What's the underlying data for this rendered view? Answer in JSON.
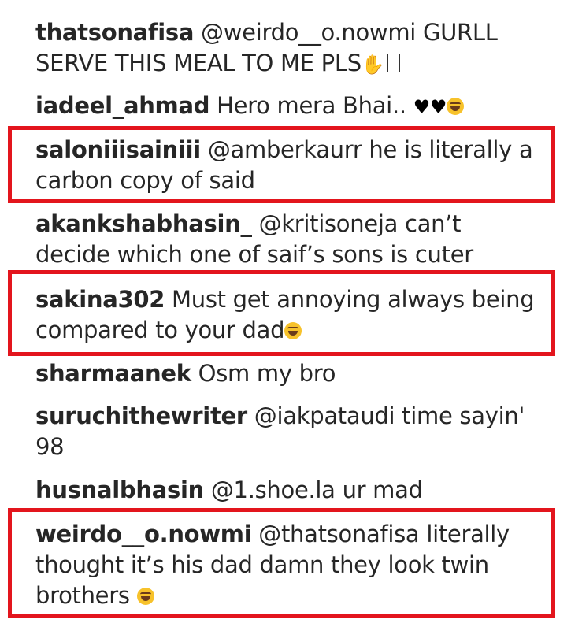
{
  "comments": [
    {
      "user": "thatsonafisa",
      "text_part1": " @weirdo__o.nowmi GURLL",
      "text_part2": "SERVE THIS MEAL TO ME PLS"
    },
    {
      "user": "iadeel_ahmad",
      "text": " Hero mera Bhai.. "
    },
    {
      "user": "saloniiisainiii",
      "text": " @amberkaurr he is literally a carbon copy of said"
    },
    {
      "user": "akankshabhasin_",
      "text": " @kritisoneja can’t decide which one of saif’s sons is cuter"
    },
    {
      "user": "sakina302",
      "text": " Must get annoying always being compared to your dad"
    },
    {
      "user": "sharmaanek",
      "text": " Osm my bro"
    },
    {
      "user": "suruchithewriter",
      "text": " @iakpataudi time sayin'",
      "text2": "98"
    },
    {
      "user": "husnalbhasin",
      "text": " @1.shoe.la ur mad"
    },
    {
      "user": "weirdo__o.nowmi",
      "text": " @thatsonafisa literally thought it’s his dad damn they look twin brothers "
    }
  ],
  "highlight_color": "#e3151d",
  "icons": [
    "raised-hand-icon",
    "missing-glyph-icon",
    "black-heart-icon",
    "astonished-face-icon",
    "tears-of-joy-icon"
  ]
}
